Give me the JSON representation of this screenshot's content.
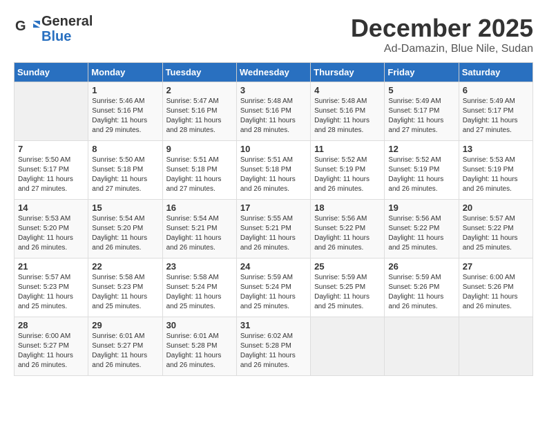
{
  "header": {
    "logo_general": "General",
    "logo_blue": "Blue",
    "month_title": "December 2025",
    "location": "Ad-Damazin, Blue Nile, Sudan"
  },
  "days_of_week": [
    "Sunday",
    "Monday",
    "Tuesday",
    "Wednesday",
    "Thursday",
    "Friday",
    "Saturday"
  ],
  "weeks": [
    [
      {
        "day": "",
        "info": ""
      },
      {
        "day": "1",
        "info": "Sunrise: 5:46 AM\nSunset: 5:16 PM\nDaylight: 11 hours\nand 29 minutes."
      },
      {
        "day": "2",
        "info": "Sunrise: 5:47 AM\nSunset: 5:16 PM\nDaylight: 11 hours\nand 28 minutes."
      },
      {
        "day": "3",
        "info": "Sunrise: 5:48 AM\nSunset: 5:16 PM\nDaylight: 11 hours\nand 28 minutes."
      },
      {
        "day": "4",
        "info": "Sunrise: 5:48 AM\nSunset: 5:16 PM\nDaylight: 11 hours\nand 28 minutes."
      },
      {
        "day": "5",
        "info": "Sunrise: 5:49 AM\nSunset: 5:17 PM\nDaylight: 11 hours\nand 27 minutes."
      },
      {
        "day": "6",
        "info": "Sunrise: 5:49 AM\nSunset: 5:17 PM\nDaylight: 11 hours\nand 27 minutes."
      }
    ],
    [
      {
        "day": "7",
        "info": "Sunrise: 5:50 AM\nSunset: 5:17 PM\nDaylight: 11 hours\nand 27 minutes."
      },
      {
        "day": "8",
        "info": "Sunrise: 5:50 AM\nSunset: 5:18 PM\nDaylight: 11 hours\nand 27 minutes."
      },
      {
        "day": "9",
        "info": "Sunrise: 5:51 AM\nSunset: 5:18 PM\nDaylight: 11 hours\nand 27 minutes."
      },
      {
        "day": "10",
        "info": "Sunrise: 5:51 AM\nSunset: 5:18 PM\nDaylight: 11 hours\nand 26 minutes."
      },
      {
        "day": "11",
        "info": "Sunrise: 5:52 AM\nSunset: 5:19 PM\nDaylight: 11 hours\nand 26 minutes."
      },
      {
        "day": "12",
        "info": "Sunrise: 5:52 AM\nSunset: 5:19 PM\nDaylight: 11 hours\nand 26 minutes."
      },
      {
        "day": "13",
        "info": "Sunrise: 5:53 AM\nSunset: 5:19 PM\nDaylight: 11 hours\nand 26 minutes."
      }
    ],
    [
      {
        "day": "14",
        "info": "Sunrise: 5:53 AM\nSunset: 5:20 PM\nDaylight: 11 hours\nand 26 minutes."
      },
      {
        "day": "15",
        "info": "Sunrise: 5:54 AM\nSunset: 5:20 PM\nDaylight: 11 hours\nand 26 minutes."
      },
      {
        "day": "16",
        "info": "Sunrise: 5:54 AM\nSunset: 5:21 PM\nDaylight: 11 hours\nand 26 minutes."
      },
      {
        "day": "17",
        "info": "Sunrise: 5:55 AM\nSunset: 5:21 PM\nDaylight: 11 hours\nand 26 minutes."
      },
      {
        "day": "18",
        "info": "Sunrise: 5:56 AM\nSunset: 5:22 PM\nDaylight: 11 hours\nand 26 minutes."
      },
      {
        "day": "19",
        "info": "Sunrise: 5:56 AM\nSunset: 5:22 PM\nDaylight: 11 hours\nand 25 minutes."
      },
      {
        "day": "20",
        "info": "Sunrise: 5:57 AM\nSunset: 5:22 PM\nDaylight: 11 hours\nand 25 minutes."
      }
    ],
    [
      {
        "day": "21",
        "info": "Sunrise: 5:57 AM\nSunset: 5:23 PM\nDaylight: 11 hours\nand 25 minutes."
      },
      {
        "day": "22",
        "info": "Sunrise: 5:58 AM\nSunset: 5:23 PM\nDaylight: 11 hours\nand 25 minutes."
      },
      {
        "day": "23",
        "info": "Sunrise: 5:58 AM\nSunset: 5:24 PM\nDaylight: 11 hours\nand 25 minutes."
      },
      {
        "day": "24",
        "info": "Sunrise: 5:59 AM\nSunset: 5:24 PM\nDaylight: 11 hours\nand 25 minutes."
      },
      {
        "day": "25",
        "info": "Sunrise: 5:59 AM\nSunset: 5:25 PM\nDaylight: 11 hours\nand 25 minutes."
      },
      {
        "day": "26",
        "info": "Sunrise: 5:59 AM\nSunset: 5:26 PM\nDaylight: 11 hours\nand 26 minutes."
      },
      {
        "day": "27",
        "info": "Sunrise: 6:00 AM\nSunset: 5:26 PM\nDaylight: 11 hours\nand 26 minutes."
      }
    ],
    [
      {
        "day": "28",
        "info": "Sunrise: 6:00 AM\nSunset: 5:27 PM\nDaylight: 11 hours\nand 26 minutes."
      },
      {
        "day": "29",
        "info": "Sunrise: 6:01 AM\nSunset: 5:27 PM\nDaylight: 11 hours\nand 26 minutes."
      },
      {
        "day": "30",
        "info": "Sunrise: 6:01 AM\nSunset: 5:28 PM\nDaylight: 11 hours\nand 26 minutes."
      },
      {
        "day": "31",
        "info": "Sunrise: 6:02 AM\nSunset: 5:28 PM\nDaylight: 11 hours\nand 26 minutes."
      },
      {
        "day": "",
        "info": ""
      },
      {
        "day": "",
        "info": ""
      },
      {
        "day": "",
        "info": ""
      }
    ]
  ]
}
